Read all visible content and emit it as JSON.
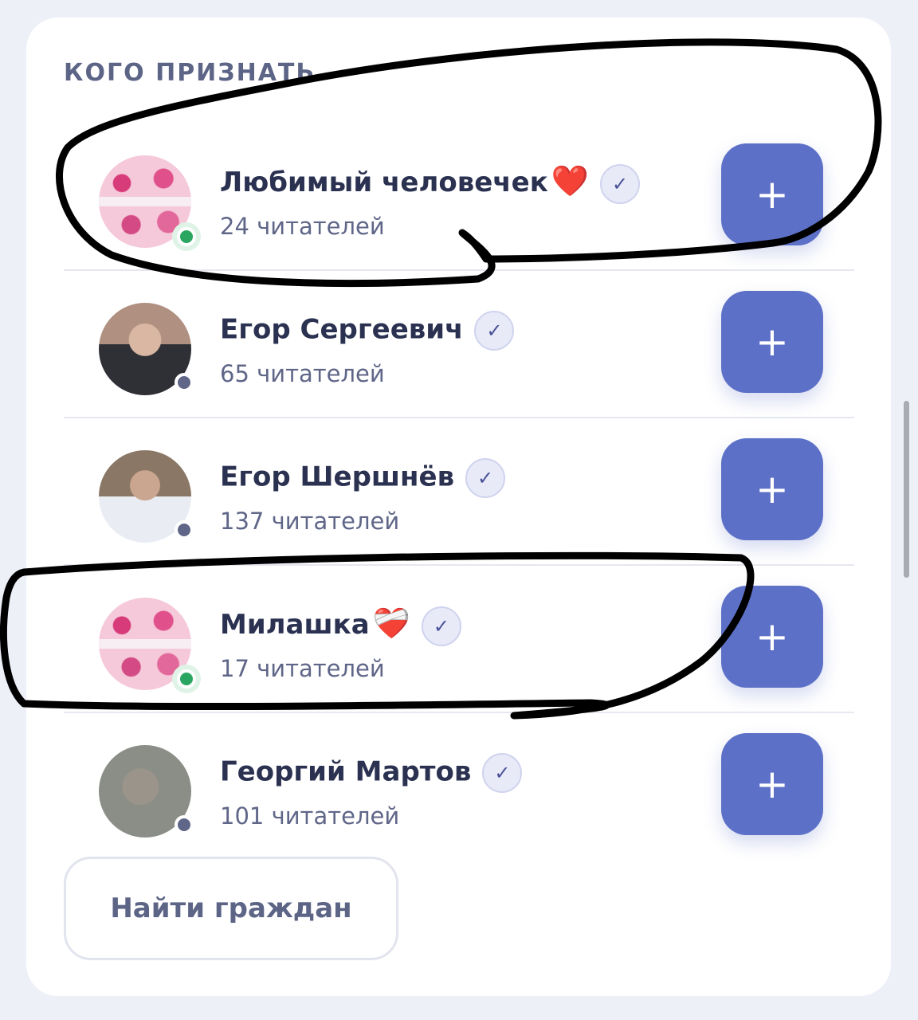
{
  "section": {
    "title": "КОГО ПРИЗНАТЬ"
  },
  "suggestions": [
    {
      "name": "Любимый человечек",
      "emoji": "❤️",
      "verified_icon": "✓",
      "followers": "24 читателей",
      "online": true,
      "add_label": "+"
    },
    {
      "name": "Егор Сергеевич",
      "emoji": "",
      "verified_icon": "✓",
      "followers": "65 читателей",
      "online": false,
      "add_label": "+"
    },
    {
      "name": "Егор Шершнёв",
      "emoji": "",
      "verified_icon": "✓",
      "followers": "137 читателей",
      "online": false,
      "add_label": "+"
    },
    {
      "name": "Милашка",
      "emoji": "❤️‍🩹",
      "verified_icon": "✓",
      "followers": "17 читателей",
      "online": true,
      "add_label": "+"
    },
    {
      "name": "Георгий Мартов",
      "emoji": "",
      "verified_icon": "✓",
      "followers": "101 читателей",
      "online": false,
      "add_label": "+"
    }
  ],
  "actions": {
    "find_label": "Найти граждан"
  },
  "colors": {
    "accent": "#5c70c7",
    "online": "#2aa661",
    "offline": "#5f6688",
    "text": "#2b3150",
    "muted": "#5f6688"
  }
}
